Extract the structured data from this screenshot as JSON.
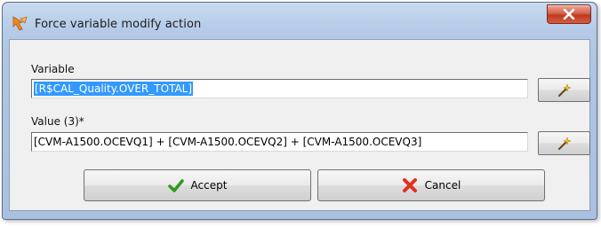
{
  "window": {
    "title": "Force variable modify action",
    "close_icon": "close-x-icon"
  },
  "fields": {
    "variable_label": "Variable",
    "variable_value": "[R$CAL_Quality.OVER_TOTAL]",
    "value_label": "Value (3)*",
    "value_value": "[CVM-A1500.OCEVQ1] +  [CVM-A1500.OCEVQ2] + [CVM-A1500.OCEVQ3]"
  },
  "buttons": {
    "accept_label": "Accept",
    "cancel_label": "Cancel"
  },
  "icons": {
    "app": "app-arrow-icon",
    "variable_picker": "wand-icon",
    "value_picker": "wand-icon",
    "accept": "checkmark-icon",
    "cancel": "red-x-icon"
  },
  "colors": {
    "selection": "#3399ff",
    "close_button": "#c13a1f",
    "accept_check": "#2e9a1a",
    "cancel_x": "#e0301e"
  }
}
